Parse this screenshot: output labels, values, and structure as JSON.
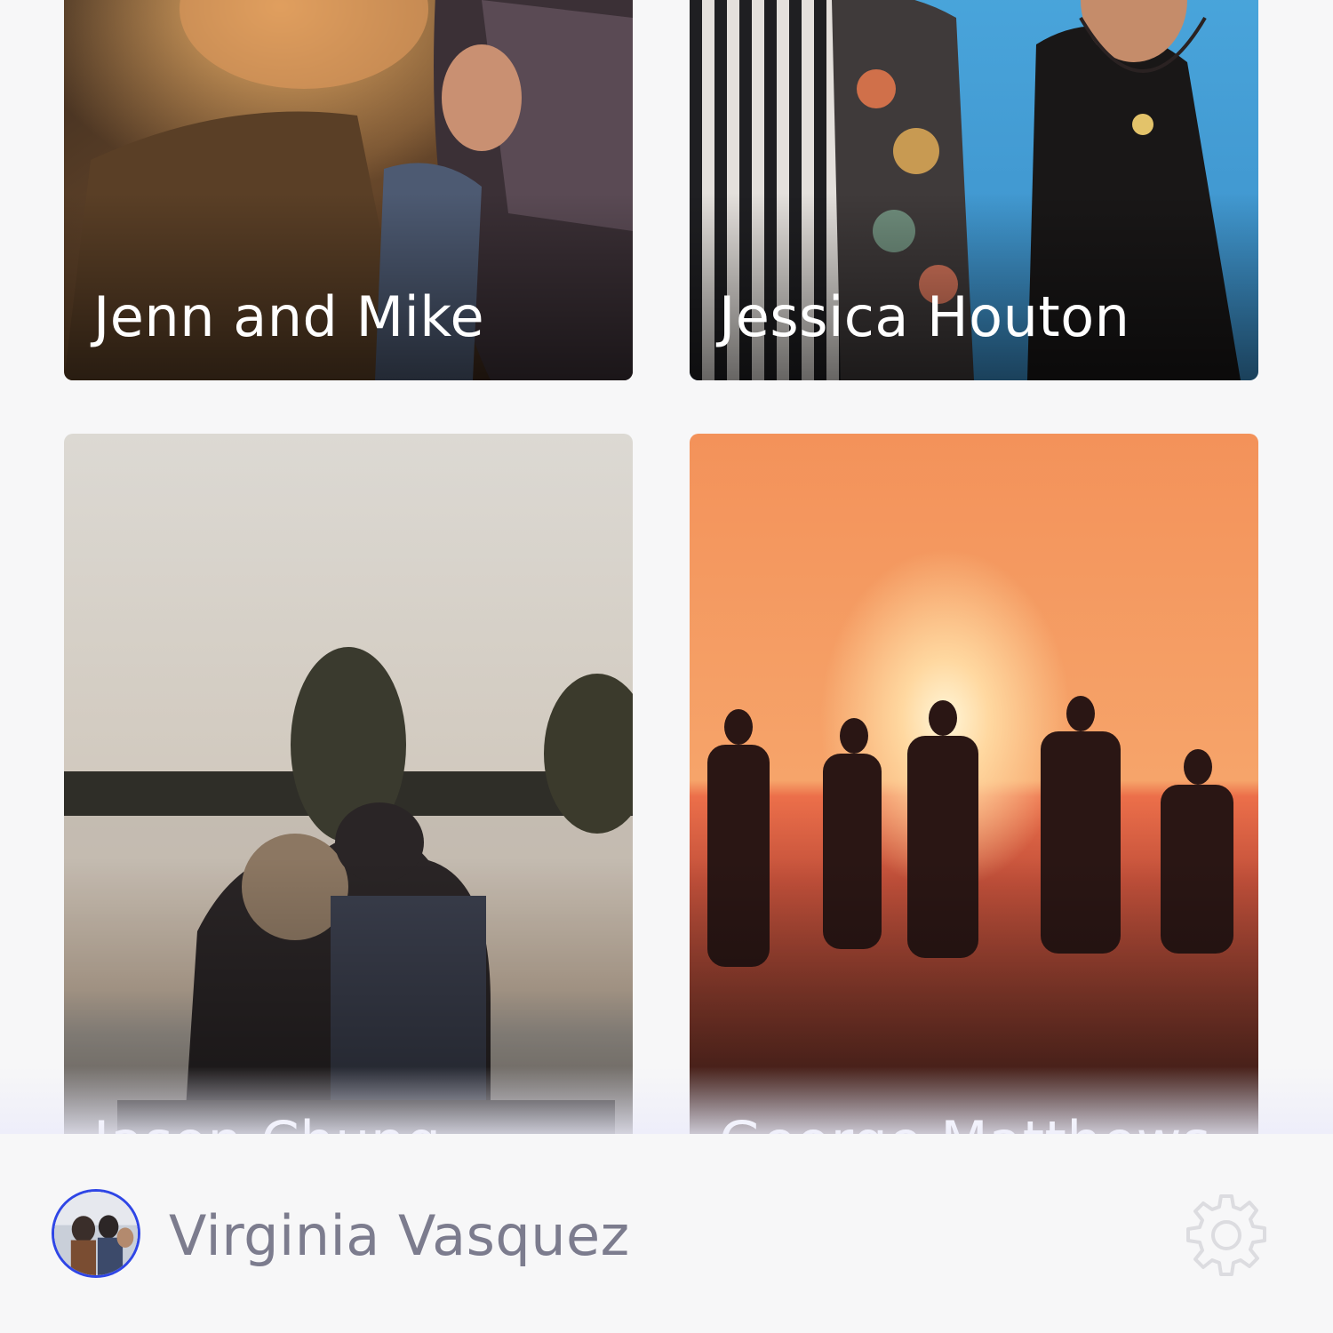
{
  "cards": [
    {
      "name": "Jenn and Mike",
      "photo": "couple-embracing-photo"
    },
    {
      "name": "Jessica Houton",
      "photo": "friends-at-beach-photo"
    },
    {
      "name": "Jason Chung",
      "photo": "couple-by-lake-sunset-photo"
    },
    {
      "name": "George Matthews",
      "photo": "family-walking-sunset-beach-photo"
    }
  ],
  "user": {
    "name": "Virginia Vasquez",
    "avatar": "user-avatar-photo"
  },
  "icons": {
    "settings": "gear-icon"
  },
  "colors": {
    "avatar_ring": "#2f46e6",
    "user_name": "#7c7c8e",
    "background": "#f7f7f8"
  }
}
